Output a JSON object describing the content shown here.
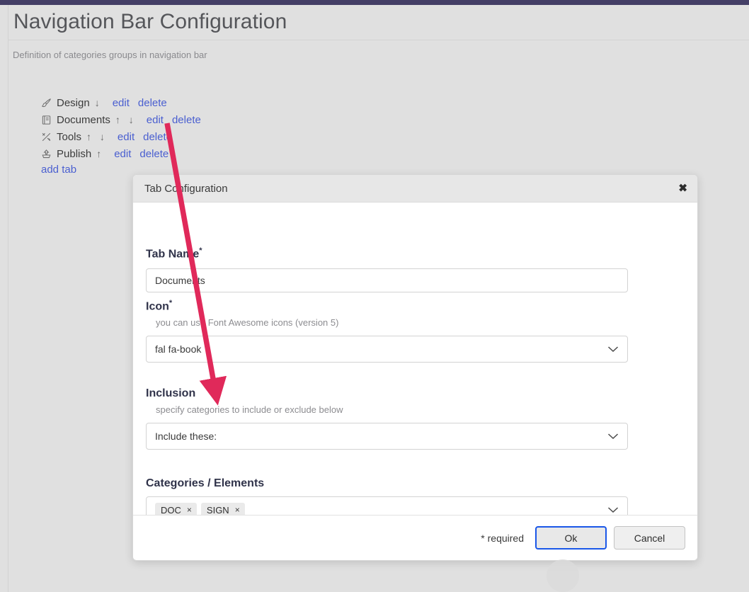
{
  "page": {
    "title": "Navigation Bar Configuration",
    "subtitle": "Definition of categories groups in navigation bar",
    "accent_bar_color": "#443f66",
    "link_color": "#4a5fd0",
    "background_color": "#e0e0e0"
  },
  "tabs": {
    "add_label": "add tab",
    "items": [
      {
        "icon": "paintbrush-icon",
        "label": "Design",
        "arrows": "↓",
        "edit": "edit",
        "delete": "delete"
      },
      {
        "icon": "book-icon",
        "label": "Documents",
        "arrows": "↑ ↓",
        "edit": "edit",
        "delete": "delete"
      },
      {
        "icon": "tools-icon",
        "label": "Tools",
        "arrows": "↑ ↓",
        "edit": "edit",
        "delete": "delete"
      },
      {
        "icon": "upload-icon",
        "label": "Publish",
        "arrows": "↑",
        "edit": "edit",
        "delete": "delete"
      }
    ]
  },
  "modal": {
    "title": "Tab Configuration",
    "close_icon": "✖",
    "fields": {
      "tab_name": {
        "label": "Tab Name",
        "required_marker": "*",
        "value": "Documents",
        "placeholder": ""
      },
      "icon": {
        "label": "Icon",
        "required_marker": "*",
        "help": "you can use Font Awesome icons (version 5)",
        "value": "fal fa-book"
      },
      "inclusion": {
        "label": "Inclusion",
        "help": "specify categories to include or exclude below",
        "value": "Include these:"
      },
      "categories": {
        "label": "Categories / Elements",
        "tags": [
          "DOC",
          "SIGN"
        ],
        "tag_remove_icon": "×"
      }
    },
    "footer": {
      "required_note": "* required",
      "ok_label": "Ok",
      "cancel_label": "Cancel",
      "focus_color": "#1a57e8"
    }
  },
  "annotation": {
    "type": "arrow",
    "color": "#e0295a",
    "from_label": "edit",
    "to_label": "Inclusion select"
  }
}
